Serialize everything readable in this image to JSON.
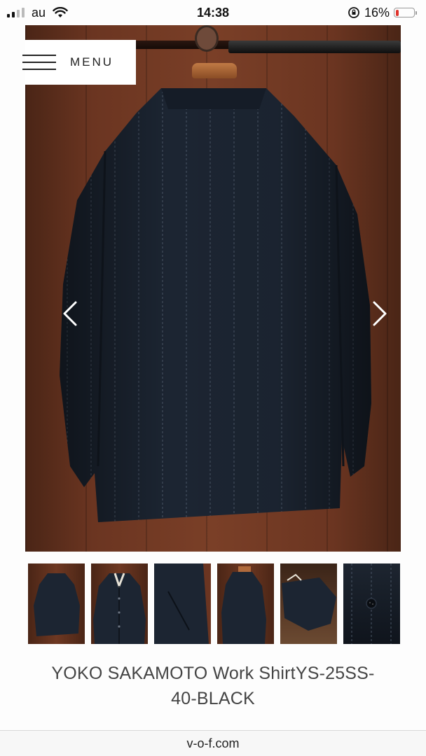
{
  "status_bar": {
    "carrier": "au",
    "time": "14:38",
    "battery_percent": "16%",
    "battery_level": 0.16,
    "battery_color": "#e0342c",
    "icons": [
      "signal-icon",
      "wifi-icon",
      "orientation-lock-icon",
      "battery-icon"
    ]
  },
  "menu": {
    "label": "MENU",
    "icon": "hamburger-icon"
  },
  "hero": {
    "prev_icon": "chevron-left-icon",
    "next_icon": "chevron-right-icon"
  },
  "thumbnails": {
    "count": 6
  },
  "product": {
    "title": "YOKO SAKAMOTO Work ShirtYS-25SS-40-BLACK"
  },
  "browser": {
    "url": "v-o-f.com"
  },
  "colors": {
    "garment": "#1b2431",
    "wood": "#6b3521",
    "text": "#444444"
  }
}
